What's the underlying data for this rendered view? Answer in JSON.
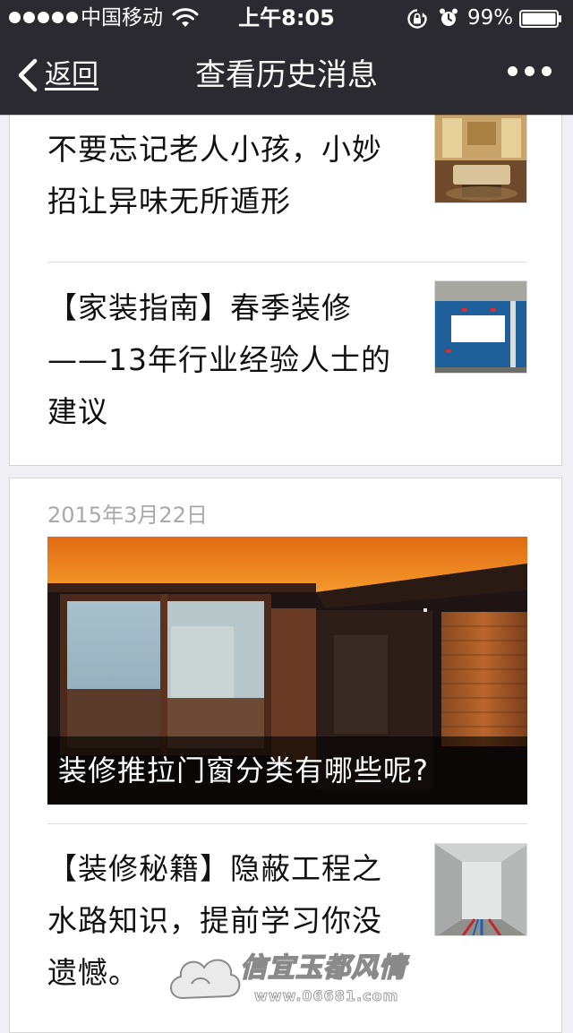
{
  "status_bar": {
    "carrier": "中国移动",
    "time": "上午8:05",
    "battery_percent": "99%",
    "battery_level": 0.99,
    "icons": [
      "signal-dots-icon",
      "wifi-icon",
      "rotation-lock-icon",
      "alarm-icon",
      "battery-icon"
    ]
  },
  "nav": {
    "back_label": "返回",
    "title": "查看历史消息",
    "more_icon": "more-dots-icon"
  },
  "cards": [
    {
      "articles": [
        {
          "title": "不要忘记老人小孩，小妙招让异味无所遁形",
          "thumb": "living-room-thumbnail"
        },
        {
          "title": "【家装指南】春季装修——13年行业经验人士的建议",
          "thumb": "blue-wall-thumbnail"
        }
      ]
    },
    {
      "date": "2015年3月22日",
      "cover_title": "装修推拉门窗分类有哪些呢?",
      "articles": [
        {
          "title": "【装修秘籍】隐蔽工程之水路知识，提前学习你没遗憾。",
          "thumb": "plumbing-thumbnail"
        }
      ]
    }
  ],
  "watermark": {
    "text": "信宜玉都风情",
    "url": "www.06681.com"
  },
  "colors": {
    "nav_bg": "#2b2a30",
    "page_bg": "#f0eff4",
    "card_bg": "#ffffff",
    "date_text": "#a9a9a9"
  }
}
